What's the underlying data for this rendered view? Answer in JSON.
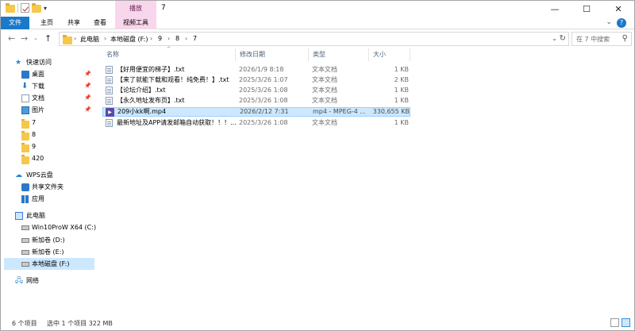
{
  "title_bar": {
    "contextual_tab": "播放",
    "window_title": "7",
    "minimize": "—",
    "maximize": "☐",
    "close": "✕"
  },
  "ribbon": {
    "tabs": [
      "文件",
      "主页",
      "共享",
      "查看",
      "视频工具"
    ],
    "help": "?"
  },
  "address_bar": {
    "breadcrumbs": [
      "此电脑",
      "本地磁盘 (F:)",
      "9",
      "8",
      "7"
    ],
    "search_placeholder": "在 7 中搜索"
  },
  "nav_pane": {
    "quick_access": "快速访问",
    "quick_items": [
      {
        "label": "桌面",
        "icon": "desktop-icon",
        "pinned": true
      },
      {
        "label": "下载",
        "icon": "download-icon",
        "pinned": true
      },
      {
        "label": "文档",
        "icon": "document-icon",
        "pinned": true
      },
      {
        "label": "图片",
        "icon": "pictures-icon",
        "pinned": true
      },
      {
        "label": "7",
        "icon": "folder-icon",
        "pinned": false
      },
      {
        "label": "8",
        "icon": "folder-icon",
        "pinned": false
      },
      {
        "label": "9",
        "icon": "folder-icon",
        "pinned": false
      },
      {
        "label": "420",
        "icon": "folder-icon",
        "pinned": false
      }
    ],
    "wps_cloud": "WPS云盘",
    "wps_items": [
      {
        "label": "共享文件夹",
        "icon": "shared-folder-icon"
      },
      {
        "label": "应用",
        "icon": "apps-icon"
      }
    ],
    "this_pc": "此电脑",
    "drives": [
      {
        "label": "Win10ProW X64 (C:)",
        "selected": false
      },
      {
        "label": "新加卷 (D:)",
        "selected": false
      },
      {
        "label": "新加卷 (E:)",
        "selected": false
      },
      {
        "label": "本地磁盘 (F:)",
        "selected": true
      }
    ],
    "network": "网络"
  },
  "file_list": {
    "columns": [
      "名称",
      "修改日期",
      "类型",
      "大小"
    ],
    "rows": [
      {
        "name": "【好用便宜的梯子】.txt",
        "date": "2026/1/9 8:18",
        "type": "文本文档",
        "size": "1 KB",
        "icon": "text-file-icon",
        "selected": false
      },
      {
        "name": "【来了就能下载和观看！纯免费！】.txt",
        "date": "2025/3/26 1:07",
        "type": "文本文档",
        "size": "2 KB",
        "icon": "text-file-icon",
        "selected": false
      },
      {
        "name": "【论坛介绍】.txt",
        "date": "2025/3/26 1:08",
        "type": "文本文档",
        "size": "1 KB",
        "icon": "text-file-icon",
        "selected": false
      },
      {
        "name": "【永久地址发布页】.txt",
        "date": "2025/3/26 1:08",
        "type": "文本文档",
        "size": "1 KB",
        "icon": "text-file-icon",
        "selected": false
      },
      {
        "name": "209小kk啊.mp4",
        "date": "2026/2/12 7:31",
        "type": "mp4 - MPEG-4 ...",
        "size": "330,655 KB",
        "icon": "video-file-icon",
        "selected": true
      },
      {
        "name": "最新地址及APP请发邮箱自动获取！！！...",
        "date": "2025/3/26 1:08",
        "type": "文本文档",
        "size": "1 KB",
        "icon": "text-file-icon",
        "selected": false
      }
    ]
  },
  "status_bar": {
    "item_count": "6 个项目",
    "selection": "选中 1 个项目  322 MB"
  }
}
